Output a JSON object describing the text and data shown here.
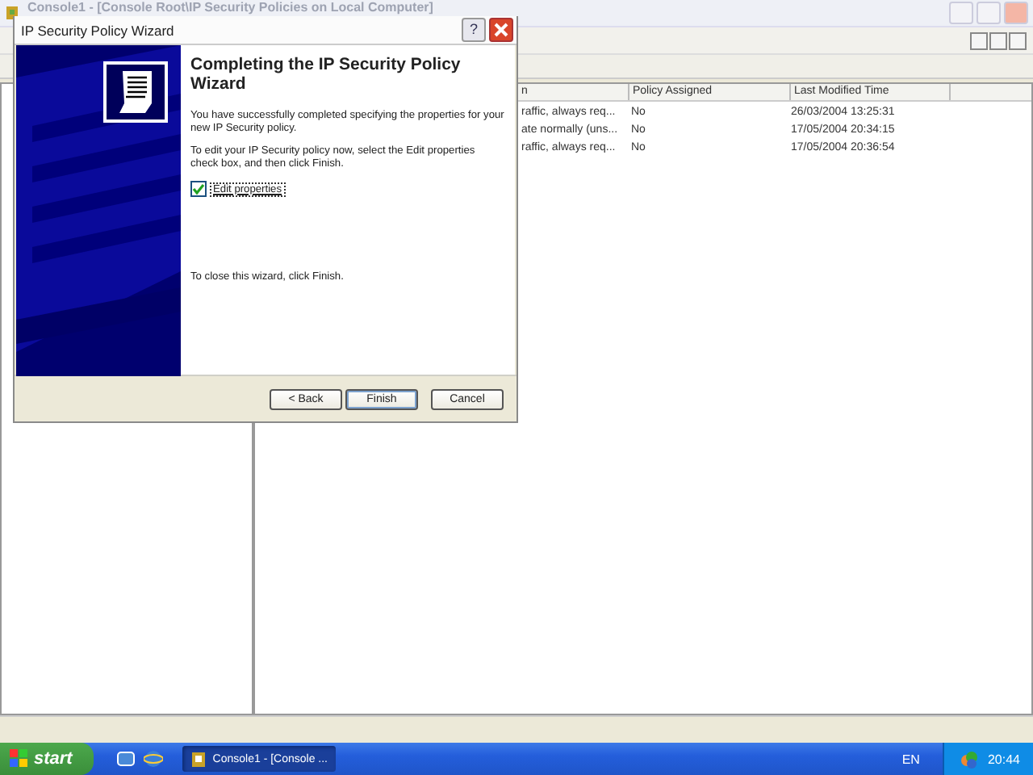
{
  "console": {
    "title": "Console1 - [Console Root\\IP Security Policies on Local Computer]",
    "list": {
      "columns": [
        "n",
        "Policy Assigned",
        "Last Modified Time"
      ],
      "rows": [
        {
          "description": "raffic, always req...",
          "assigned": "No",
          "modified": "26/03/2004 13:25:31"
        },
        {
          "description": "ate normally (uns...",
          "assigned": "No",
          "modified": "17/05/2004 20:34:15"
        },
        {
          "description": "raffic, always req...",
          "assigned": "No",
          "modified": "17/05/2004 20:36:54"
        }
      ]
    }
  },
  "dialog": {
    "title": "IP Security Policy Wizard",
    "help": "?",
    "heading": "Completing the IP Security Policy Wizard",
    "paragraphs": [
      "You have successfully completed specifying the properties for your new IP Security policy.",
      "To edit your IP Security policy now, select the Edit properties check box, and then click Finish."
    ],
    "checkbox": {
      "label": "Edit properties",
      "checked": true
    },
    "closing": "To close this wizard, click Finish.",
    "buttons": [
      {
        "label": "< Back",
        "default": false
      },
      {
        "label": "Finish",
        "default": true
      },
      {
        "label": "Cancel",
        "default": false
      }
    ]
  },
  "taskbar": {
    "start": "start",
    "tasks": [
      {
        "label": "Console1 - [Console ...",
        "selected": true
      }
    ],
    "language": "EN",
    "clock": "20:44"
  }
}
